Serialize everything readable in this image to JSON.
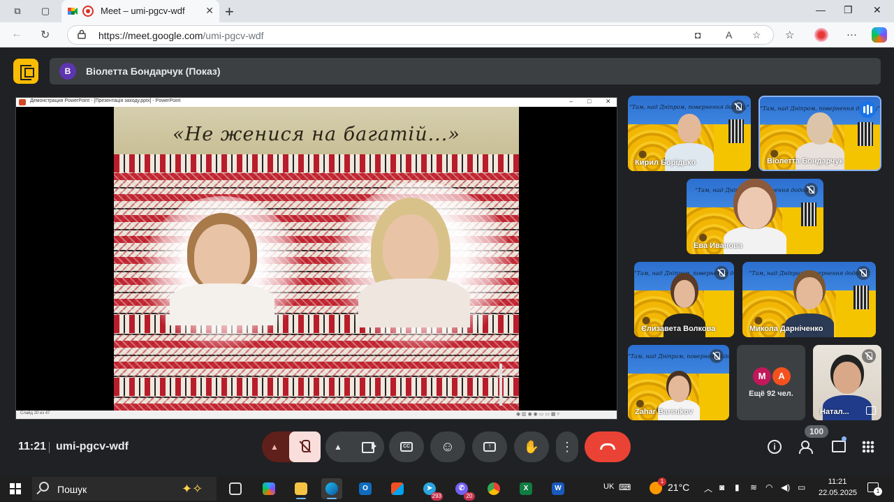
{
  "browser": {
    "tab_title": "Meet – umi-pgcv-wdf",
    "url_host": "https://meet.google.com",
    "url_path": "/umi-pgcv-wdf"
  },
  "meet": {
    "presenter_initial": "B",
    "presenter_label": "Віолетта Бондарчук (Показ)",
    "ppt": {
      "window_title": "Демонстрация PowerPoint - [Презентація заходу.pptx] - PowerPoint",
      "slide_heading": "«Не женися на багатій...»",
      "status": "Слайд 20 из 47"
    },
    "tile_caption": "\"Там, над Дніпром, повернення додому\"",
    "participants": [
      {
        "name": "Кирил Борідько"
      },
      {
        "name": "Віолетта Бондарчук"
      },
      {
        "name": "Ева Иванова"
      },
      {
        "name": "Єлизавета Волкова"
      },
      {
        "name": "Микола Дарніченко"
      },
      {
        "name": "Zahar Barsukov"
      },
      {
        "name": "Натал..."
      }
    ],
    "more": {
      "avatar1": "М",
      "avatar2": "А",
      "label": "Ещё 92 чел."
    },
    "clock": "11:21",
    "meeting_code": "umi-pgcv-wdf",
    "participant_count": "100"
  },
  "taskbar": {
    "search_placeholder": "Пошук",
    "telegram_badge": "293",
    "viber_badge": "20",
    "lang": "UK",
    "weather_badge": "1",
    "temperature": "21°C",
    "time": "11:21",
    "date": "22.05.2025",
    "notif_count": "1"
  },
  "colors": {
    "meet_bg": "#202124",
    "leave": "#ea4335",
    "presenting": "#fbbc04",
    "mic_off_bg": "#f9dedc"
  }
}
